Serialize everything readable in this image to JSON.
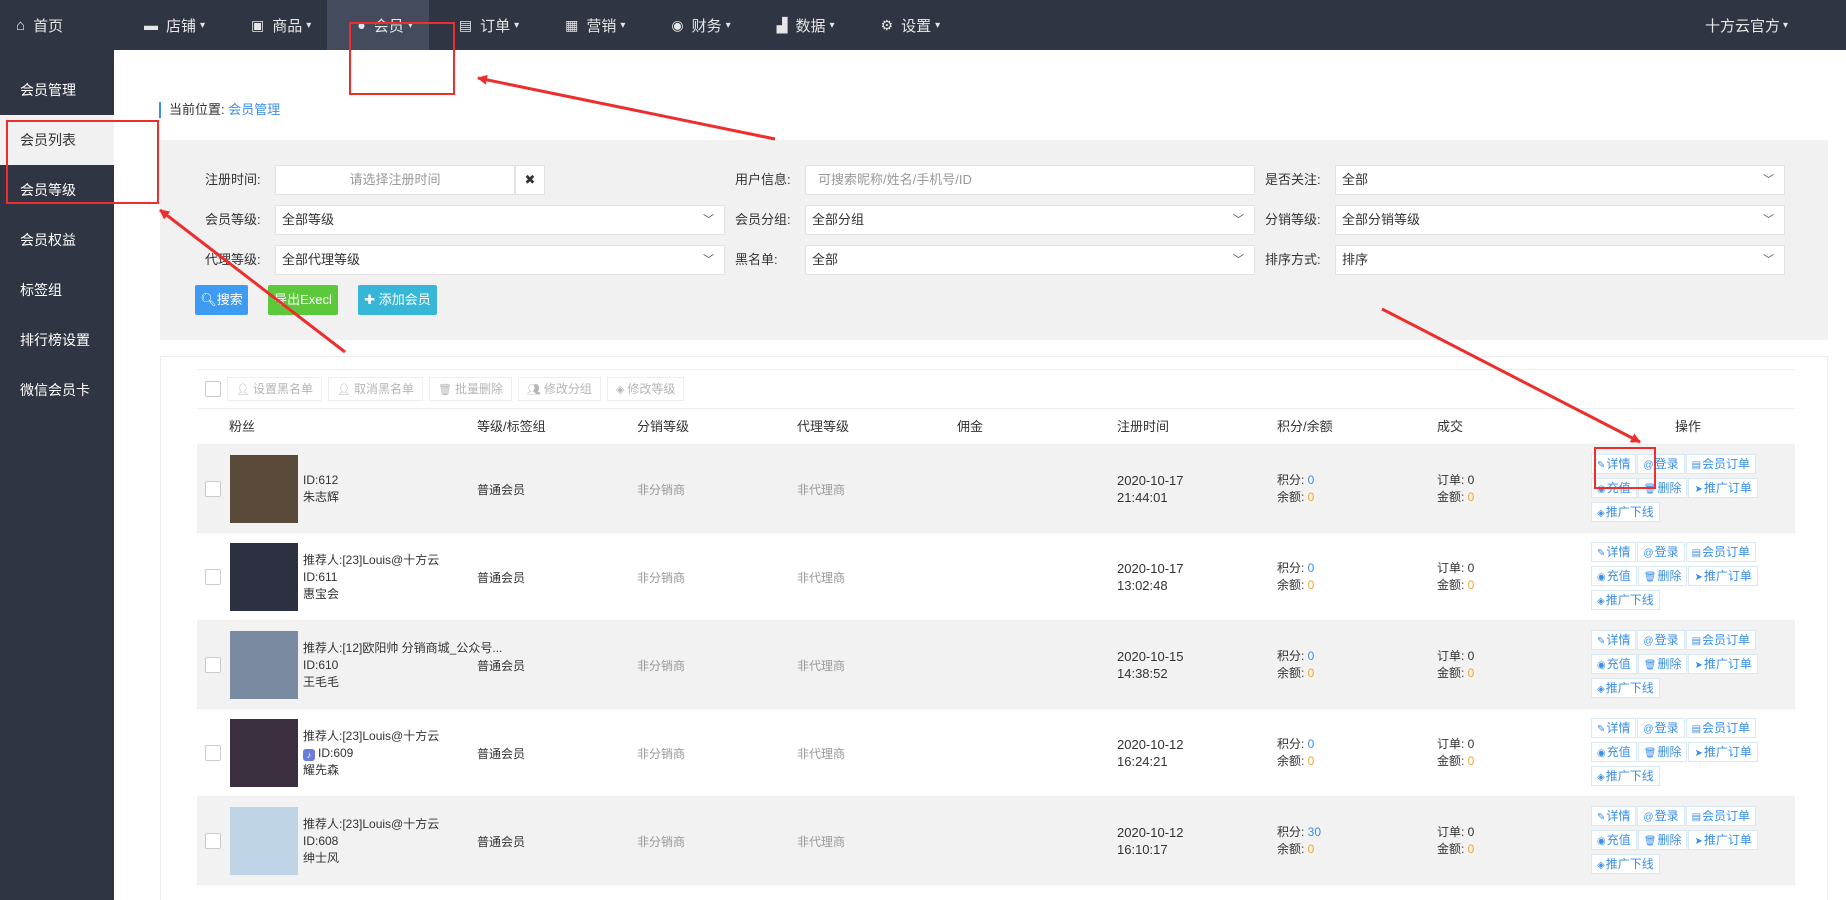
{
  "topnav": {
    "home": "首页",
    "items": [
      {
        "label": "店铺",
        "icon": "store-icon"
      },
      {
        "label": "商品",
        "icon": "goods-icon"
      },
      {
        "label": "会员",
        "icon": "member-icon"
      },
      {
        "label": "订单",
        "icon": "order-icon"
      },
      {
        "label": "营销",
        "icon": "gift-icon"
      },
      {
        "label": "财务",
        "icon": "money-bag-icon"
      },
      {
        "label": "数据",
        "icon": "chart-icon"
      },
      {
        "label": "设置",
        "icon": "gear-icon"
      }
    ],
    "active_index": 2,
    "user": "十方云官方"
  },
  "sidebar": {
    "items": [
      "会员管理",
      "会员列表",
      "会员等级",
      "会员权益",
      "标签组",
      "排行榜设置",
      "微信会员卡"
    ],
    "active_index": 1
  },
  "breadcrumb": {
    "prefix": "当前位置:",
    "current": "会员管理"
  },
  "filters": {
    "reg_time_label": "注册时间:",
    "reg_time_placeholder": "请选择注册时间",
    "clear": "✖",
    "user_info_label": "用户信息:",
    "user_info_placeholder": "可搜索昵称/姓名/手机号/ID",
    "follow_label": "是否关注:",
    "follow_value": "全部",
    "level_label": "会员等级:",
    "level_value": "全部等级",
    "group_label": "会员分组:",
    "group_value": "全部分组",
    "dist_label": "分销等级:",
    "dist_value": "全部分销等级",
    "agent_label": "代理等级:",
    "agent_value": "全部代理等级",
    "black_label": "黑名单:",
    "black_value": "全部",
    "sort_label": "排序方式:",
    "sort_value": "排序",
    "search_btn": "搜索",
    "export_btn": "导出Execl",
    "add_btn": "添加会员"
  },
  "toolbar": [
    "设置黑名单",
    "取消黑名单",
    "批量删除",
    "修改分组",
    "修改等级"
  ],
  "columns": [
    "粉丝",
    "等级/标签组",
    "分销等级",
    "代理等级",
    "佣金",
    "注册时间",
    "积分/余额",
    "成交",
    "操作"
  ],
  "labels": {
    "points": "积分: ",
    "balance": "余额: ",
    "orders": "订单: ",
    "amount": "金额: "
  },
  "ops": [
    "详情",
    "登录",
    "会员订单",
    "充值",
    "删除",
    "推广订单",
    "推广下线"
  ],
  "rows": [
    {
      "referrer": "",
      "id": "ID:612",
      "name": "朱志辉",
      "level": "普通会员",
      "dist": "非分销商",
      "agent": "非代理商",
      "date": "2020-10-17",
      "time": "21:44:01",
      "points": "0",
      "balance": "0",
      "orders": "0",
      "amount": "0",
      "tiktok": false
    },
    {
      "referrer": "推荐人:[23]Louis@十方云",
      "id": "ID:611",
      "name": "惠宝会",
      "level": "普通会员",
      "dist": "非分销商",
      "agent": "非代理商",
      "date": "2020-10-17",
      "time": "13:02:48",
      "points": "0",
      "balance": "0",
      "orders": "0",
      "amount": "0",
      "tiktok": false
    },
    {
      "referrer": "推荐人:[12]欧阳帅 分销商城_公众号...",
      "id": "ID:610",
      "name": "王毛毛",
      "level": "普通会员",
      "dist": "非分销商",
      "agent": "非代理商",
      "date": "2020-10-15",
      "time": "14:38:52",
      "points": "0",
      "balance": "0",
      "orders": "0",
      "amount": "0",
      "tiktok": false
    },
    {
      "referrer": "推荐人:[23]Louis@十方云",
      "id": "ID:609",
      "name": "耀先森",
      "level": "普通会员",
      "dist": "非分销商",
      "agent": "非代理商",
      "date": "2020-10-12",
      "time": "16:24:21",
      "points": "0",
      "balance": "0",
      "orders": "0",
      "amount": "0",
      "tiktok": true
    },
    {
      "referrer": "推荐人:[23]Louis@十方云",
      "id": "ID:608",
      "name": "绅士风",
      "level": "普通会员",
      "dist": "非分销商",
      "agent": "非代理商",
      "date": "2020-10-12",
      "time": "16:10:17",
      "points": "30",
      "balance": "0",
      "orders": "0",
      "amount": "0",
      "tiktok": false
    }
  ],
  "colors": {
    "nav_bg": "#2f3542",
    "accent": "#3a8ee6",
    "annotation": "#ee2d2d",
    "balance": "#f5a623"
  }
}
